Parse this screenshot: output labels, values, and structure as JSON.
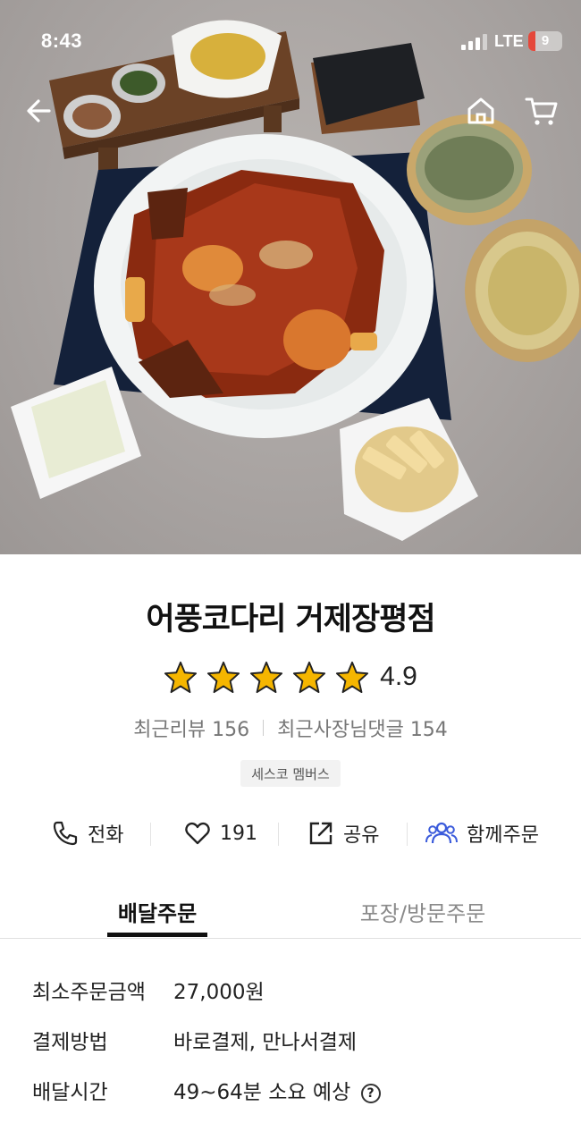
{
  "status_bar": {
    "time": "8:43",
    "network": "LTE",
    "battery": "9",
    "battery_color": "#e5483b"
  },
  "hero": {
    "image_alt": "braised pollack dish with side dishes",
    "icons": [
      "back-arrow-icon",
      "home-icon",
      "cart-icon"
    ]
  },
  "store": {
    "name": "어풍코다리 거제장평점",
    "rating": "4.9",
    "star_count": 5,
    "star_color": "#f5b600",
    "recent_reviews_label": "최근리뷰 156",
    "recent_owner_comments_label": "최근사장님댓글 154",
    "badge": "세스코 멤버스"
  },
  "actions": {
    "phone_label": "전화",
    "likes_label": "191",
    "share_label": "공유",
    "group_order_label": "함께주문",
    "group_order_color": "#3b5bdb"
  },
  "tabs": [
    {
      "label": "배달주문",
      "active": true
    },
    {
      "label": "포장/방문주문",
      "active": false
    }
  ],
  "delivery_info": [
    {
      "key": "최소주문금액",
      "value": "27,000원"
    },
    {
      "key": "결제방법",
      "value": "바로결제, 만나서결제"
    },
    {
      "key": "배달시간",
      "value": "49~64분 소요 예상"
    }
  ],
  "help_icon_glyph": "?"
}
